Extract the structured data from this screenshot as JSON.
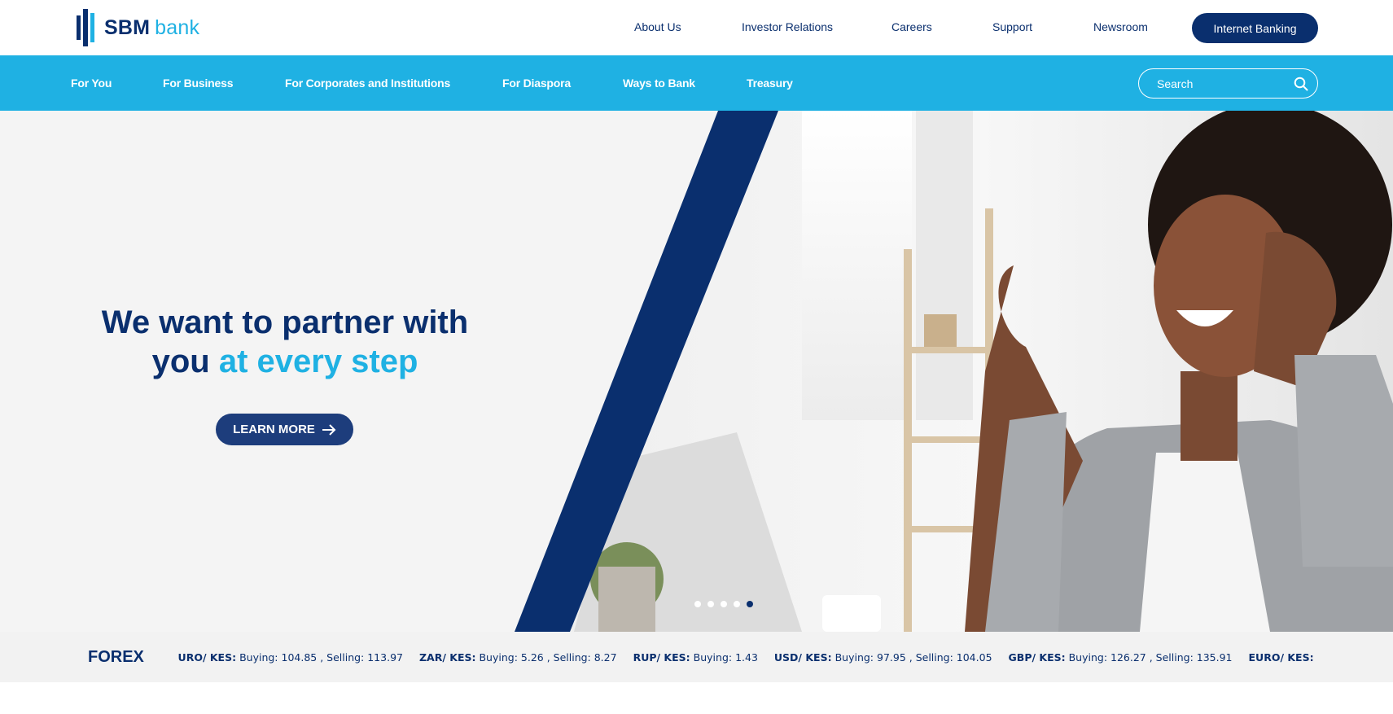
{
  "brand": {
    "name_bold": "SBM",
    "name_light": "bank",
    "primary": "#0a2f6e",
    "accent": "#1fb1e3"
  },
  "top_nav": {
    "links": [
      "About Us",
      "Investor Relations",
      "Careers",
      "Support",
      "Newsroom"
    ],
    "cta": "Internet Banking"
  },
  "main_nav": {
    "items": [
      "For You",
      "For Business",
      "For Corporates and Institutions",
      "For Diaspora",
      "Ways to Bank",
      "Treasury"
    ],
    "search_placeholder": "Search"
  },
  "hero": {
    "title_line1": "We want to partner with",
    "title_line2_plain": "you",
    "title_line2_accent": "at every step",
    "button_label": "LEARN MORE",
    "slide_count": 5,
    "active_slide": 5
  },
  "forex": {
    "label": "FOREX",
    "rates": [
      {
        "pair": "EURO/ KES:",
        "detail": "Buying: 104.85 , Selling: 113.97"
      },
      {
        "pair": "ZAR/ KES:",
        "detail": "Buying: 5.26 , Selling: 8.27"
      },
      {
        "pair": "RUP/ KES:",
        "detail": "Buying: 1.43"
      },
      {
        "pair": "USD/ KES:",
        "detail": "Buying: 97.95 , Selling: 104.05"
      },
      {
        "pair": "GBP/ KES:",
        "detail": "Buying: 126.27 , Selling: 135.91"
      },
      {
        "pair": "EURO/ KES:",
        "detail": ""
      }
    ]
  }
}
